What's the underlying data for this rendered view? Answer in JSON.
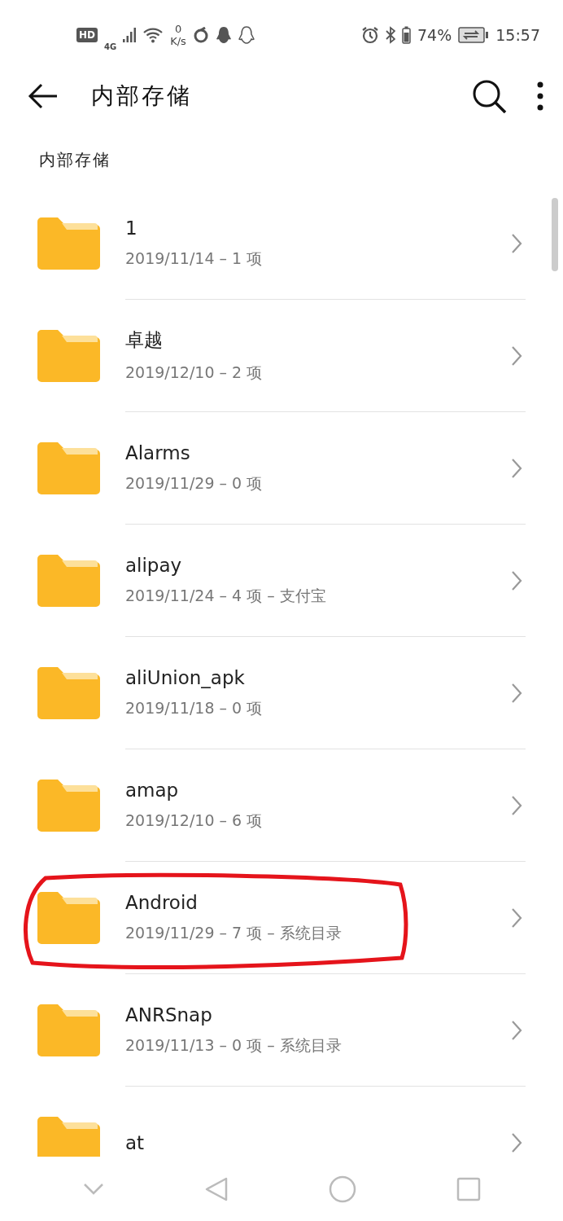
{
  "status_bar": {
    "left_badges": [
      "HD",
      "4G"
    ],
    "speed_value": "0",
    "speed_unit": "K/s",
    "battery": "74%",
    "time": "15:57"
  },
  "app_bar": {
    "title": "内部存储"
  },
  "breadcrumb": "内部存储",
  "folders": [
    {
      "name": "1",
      "details": "2019/11/14 – 1 项",
      "circled": false
    },
    {
      "name": "卓越",
      "details": "2019/12/10 – 2 项",
      "circled": false
    },
    {
      "name": "Alarms",
      "details": "2019/11/29 – 0 项",
      "circled": false
    },
    {
      "name": "alipay",
      "details": "2019/11/24 – 4 项 – 支付宝",
      "circled": false
    },
    {
      "name": "aliUnion_apk",
      "details": "2019/11/18 – 0 项",
      "circled": false
    },
    {
      "name": "amap",
      "details": "2019/12/10 – 6 项",
      "circled": false
    },
    {
      "name": "Android",
      "details": "2019/11/29 – 7 项 – 系统目录",
      "circled": true
    },
    {
      "name": "ANRSnap",
      "details": "2019/11/13 – 0 项 – 系统目录",
      "circled": false
    },
    {
      "name": "at",
      "circled": false
    }
  ]
}
